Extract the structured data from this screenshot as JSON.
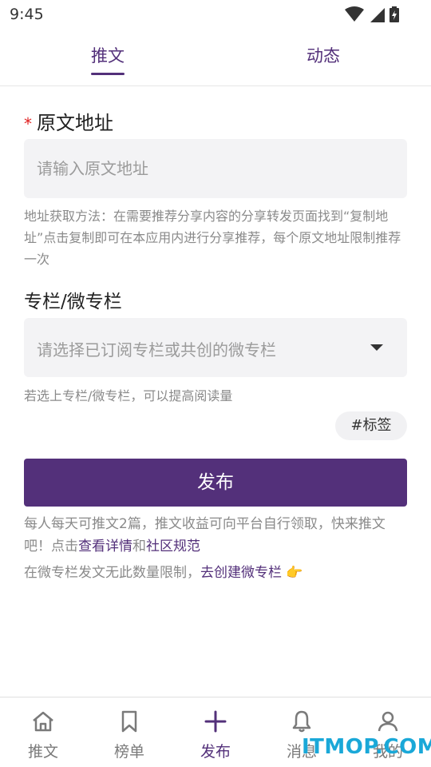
{
  "status_bar": {
    "time": "9:45"
  },
  "tabs": [
    {
      "label": "推文"
    },
    {
      "label": "动态"
    }
  ],
  "form": {
    "url_label": "原文地址",
    "url_required_mark": "*",
    "url_placeholder": "请输入原文地址",
    "url_hint": "地址获取方法：在需要推荐分享内容的分享转发页面找到“复制地址”点击复制即可在本应用内进行分享推荐，每个原文地址限制推荐一次",
    "column_label": "专栏/微专栏",
    "column_placeholder": "请选择已订阅专栏或共创的微专栏",
    "column_hint": "若选上专栏/微专栏，可以提高阅读量",
    "tag_chip": "#标签",
    "publish_label": "发布"
  },
  "notes": {
    "line1_prefix": "每人每天可推文2篇，推文收益可向平台自行领取，快来推文吧！点击",
    "link_details": "查看详情",
    "and": "和",
    "link_rules": "社区规范",
    "line2_prefix": "在微专栏发文无此数量限制，",
    "link_create": "去创建微专栏",
    "hand_emoji": "👉"
  },
  "bottom_nav": [
    {
      "label": "推文",
      "icon": "home-icon"
    },
    {
      "label": "榜单",
      "icon": "bookmark-icon"
    },
    {
      "label": "发布",
      "icon": "plus-icon"
    },
    {
      "label": "消息",
      "icon": "bell-icon"
    },
    {
      "label": "我的",
      "icon": "user-icon"
    }
  ],
  "colors": {
    "accent": "#53307a",
    "hint": "#8a8a8a",
    "field_bg": "#f3f3f5",
    "required": "#e02020"
  },
  "watermark": "ITMOP.COM"
}
